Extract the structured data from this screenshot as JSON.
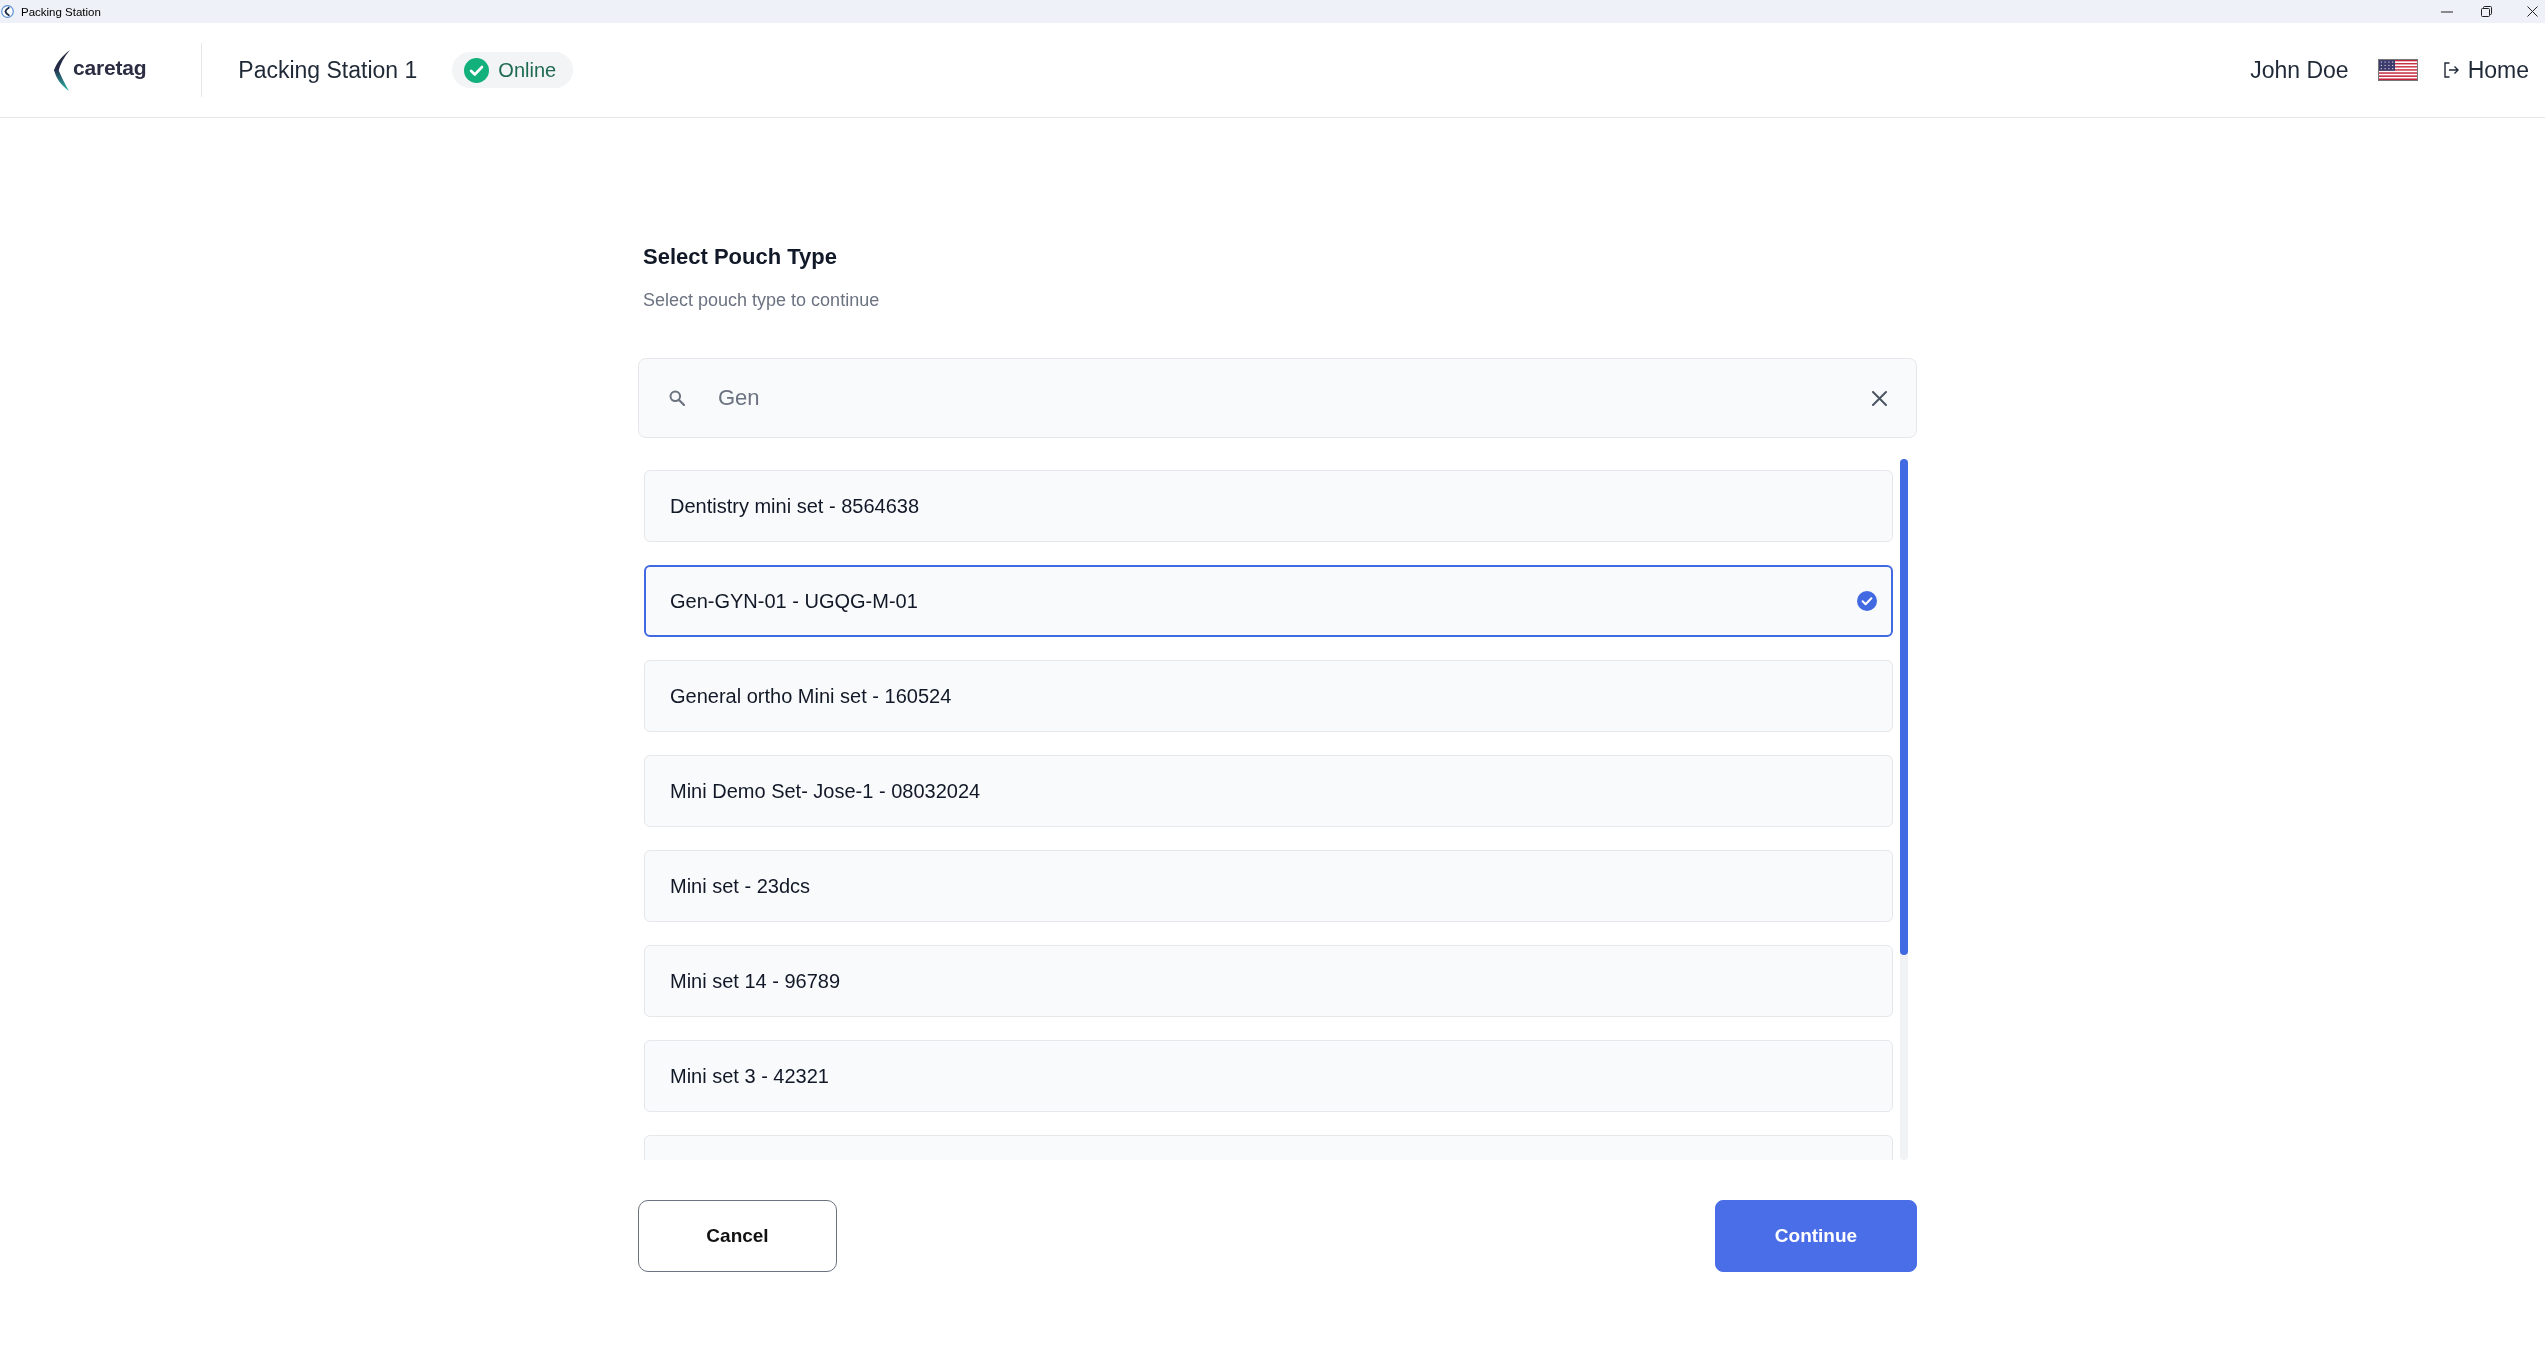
{
  "window": {
    "title": "Packing Station"
  },
  "header": {
    "logo_text": "caretag",
    "station": "Packing Station 1",
    "status": {
      "label": "Online",
      "online": true
    },
    "user": "John Doe",
    "home_link": "Home"
  },
  "page": {
    "title": "Select Pouch Type",
    "subtitle": "Select pouch type to continue"
  },
  "search": {
    "value": "Gen"
  },
  "pouch_types": [
    {
      "label": "Dentistry mini set - 8564638",
      "selected": false
    },
    {
      "label": "Gen-GYN-01 - UGQG-M-01",
      "selected": true
    },
    {
      "label": "General ortho Mini set - 160524",
      "selected": false
    },
    {
      "label": "Mini Demo Set- Jose-1 - 08032024",
      "selected": false
    },
    {
      "label": "Mini set - 23dcs",
      "selected": false
    },
    {
      "label": "Mini set 14 - 96789",
      "selected": false
    },
    {
      "label": "Mini set 3 - 42321",
      "selected": false
    },
    {
      "selected": false
    }
  ],
  "buttons": [
    {
      "label": "Cancel",
      "kind": "secondary"
    },
    {
      "label": "Continue",
      "kind": "primary"
    }
  ]
}
